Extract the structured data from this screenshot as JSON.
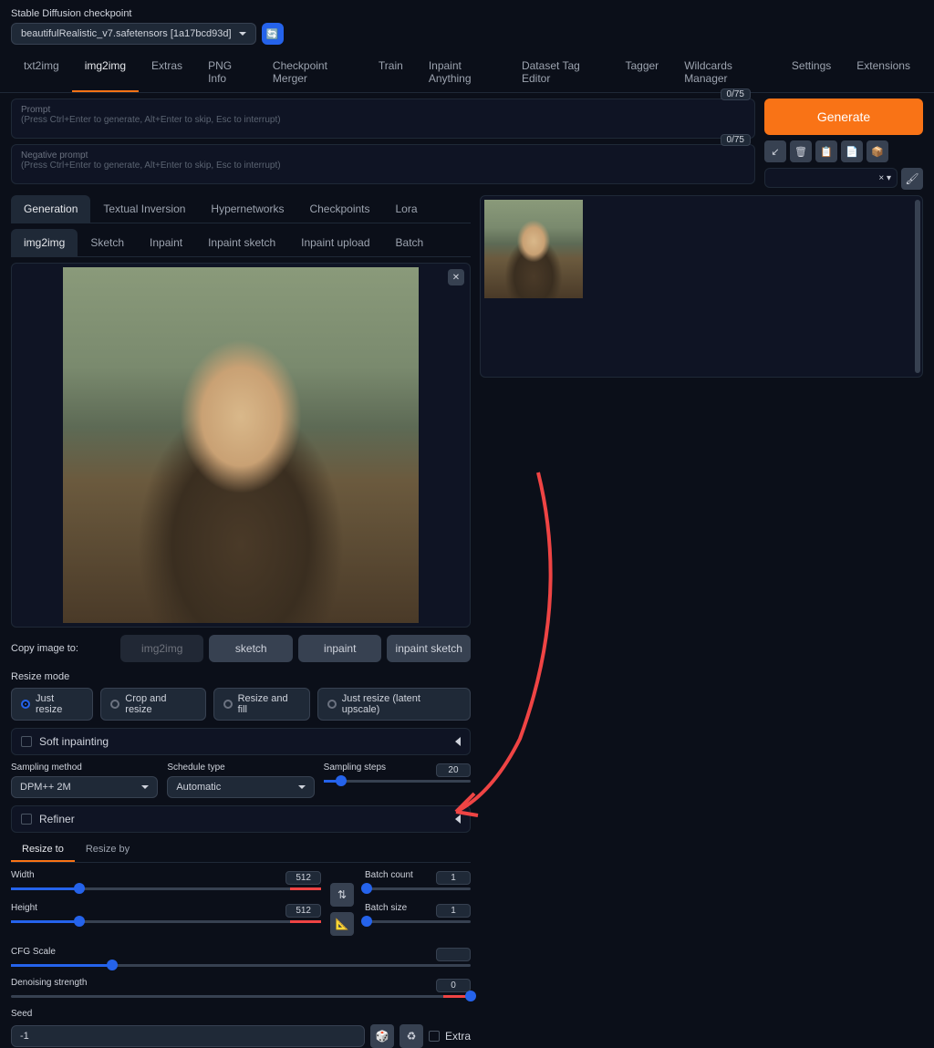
{
  "checkpoint": {
    "label": "Stable Diffusion checkpoint",
    "value": "beautifulRealistic_v7.safetensors [1a17bcd93d]"
  },
  "main_tabs": [
    "txt2img",
    "img2img",
    "Extras",
    "PNG Info",
    "Checkpoint Merger",
    "Train",
    "Inpaint Anything",
    "Dataset Tag Editor",
    "Tagger",
    "Wildcards Manager",
    "Settings",
    "Extensions"
  ],
  "main_tab_active": "img2img",
  "prompt": {
    "label": "Prompt",
    "hint": "(Press Ctrl+Enter to generate, Alt+Enter to skip, Esc to interrupt)",
    "tokens": "0/75"
  },
  "neg_prompt": {
    "label": "Negative prompt",
    "hint": "(Press Ctrl+Enter to generate, Alt+Enter to skip, Esc to interrupt)",
    "tokens": "0/75"
  },
  "generate": "Generate",
  "styles_clear": "× ▾",
  "sub_tabs": [
    "Generation",
    "Textual Inversion",
    "Hypernetworks",
    "Checkpoints",
    "Lora"
  ],
  "sub_tab_active": "Generation",
  "sub_tabs2": [
    "img2img",
    "Sketch",
    "Inpaint",
    "Inpaint sketch",
    "Inpaint upload",
    "Batch"
  ],
  "sub_tab2_active": "img2img",
  "copy": {
    "label": "Copy image to:",
    "buttons": [
      "img2img",
      "sketch",
      "inpaint",
      "inpaint sketch"
    ]
  },
  "resize_mode": {
    "label": "Resize mode",
    "options": [
      "Just resize",
      "Crop and resize",
      "Resize and fill",
      "Just resize (latent upscale)"
    ],
    "active": "Just resize"
  },
  "soft_inpainting": "Soft inpainting",
  "sampling_method": {
    "label": "Sampling method",
    "value": "DPM++ 2M"
  },
  "schedule_type": {
    "label": "Schedule type",
    "value": "Automatic"
  },
  "sampling_steps": {
    "label": "Sampling steps",
    "value": "20"
  },
  "refiner": "Refiner",
  "resize_tabs": [
    "Resize to",
    "Resize by"
  ],
  "resize_tab_active": "Resize to",
  "width": {
    "label": "Width",
    "value": "512"
  },
  "height": {
    "label": "Height",
    "value": "512"
  },
  "batch_count": {
    "label": "Batch count",
    "value": "1"
  },
  "batch_size": {
    "label": "Batch size",
    "value": "1"
  },
  "cfg": {
    "label": "CFG Scale"
  },
  "denoise": {
    "label": "Denoising strength",
    "value": "0"
  },
  "seed": {
    "label": "Seed",
    "value": "-1"
  },
  "extra_label": "Extra"
}
